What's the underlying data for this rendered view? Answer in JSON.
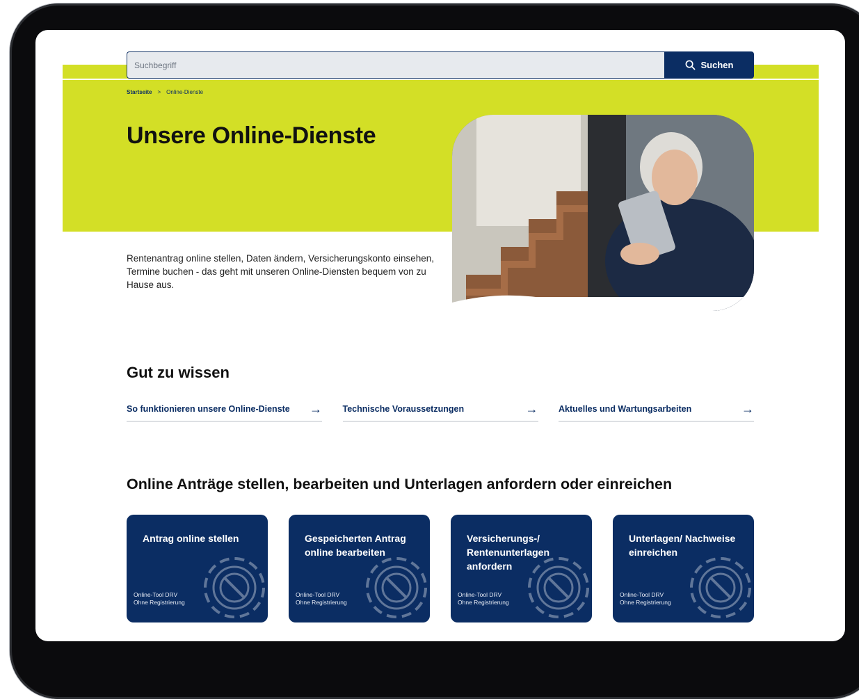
{
  "search": {
    "placeholder": "Suchbegriff",
    "button_label": "Suchen"
  },
  "breadcrumb": {
    "home": "Startseite",
    "separator": ">",
    "current": "Online-Dienste"
  },
  "hero": {
    "title": "Unsere Online-Dienste",
    "intro": "Rentenantrag online stellen, Daten ändern, Versicherungskonto einsehen, Termine buchen - das geht mit unseren Online-Diensten bequem von zu Hause aus."
  },
  "gut_zu_wissen": {
    "heading": "Gut zu wissen",
    "links": [
      {
        "label": "So funktionieren unsere Online-Dienste"
      },
      {
        "label": "Technische Voraussetzungen"
      },
      {
        "label": "Aktuelles und Wartungsarbeiten"
      }
    ]
  },
  "antraege": {
    "heading": "Online Anträge stellen, bearbeiten und Unterlagen anfordern oder einreichen",
    "cards": [
      {
        "title": "Antrag online stellen",
        "meta_line1": "Online-Tool DRV",
        "meta_line2": "Ohne Registrierung"
      },
      {
        "title": "Gespeicherten Antrag online bearbeiten",
        "meta_line1": "Online-Tool DRV",
        "meta_line2": "Ohne Registrierung"
      },
      {
        "title": "Versicherungs-/ Rentenunterlagen anfordern",
        "meta_line1": "Online-Tool DRV",
        "meta_line2": "Ohne Registrierung"
      },
      {
        "title": "Unterlagen/ Nachweise einreichen",
        "meta_line1": "Online-Tool DRV",
        "meta_line2": "Ohne Registrierung"
      }
    ]
  },
  "icons": {
    "search": "search-icon",
    "arrow": "arrow-right-icon",
    "card_decoration": "gear-pencil-icon"
  },
  "colors": {
    "accent_lime": "#d3df26",
    "navy": "#0b2d63"
  }
}
